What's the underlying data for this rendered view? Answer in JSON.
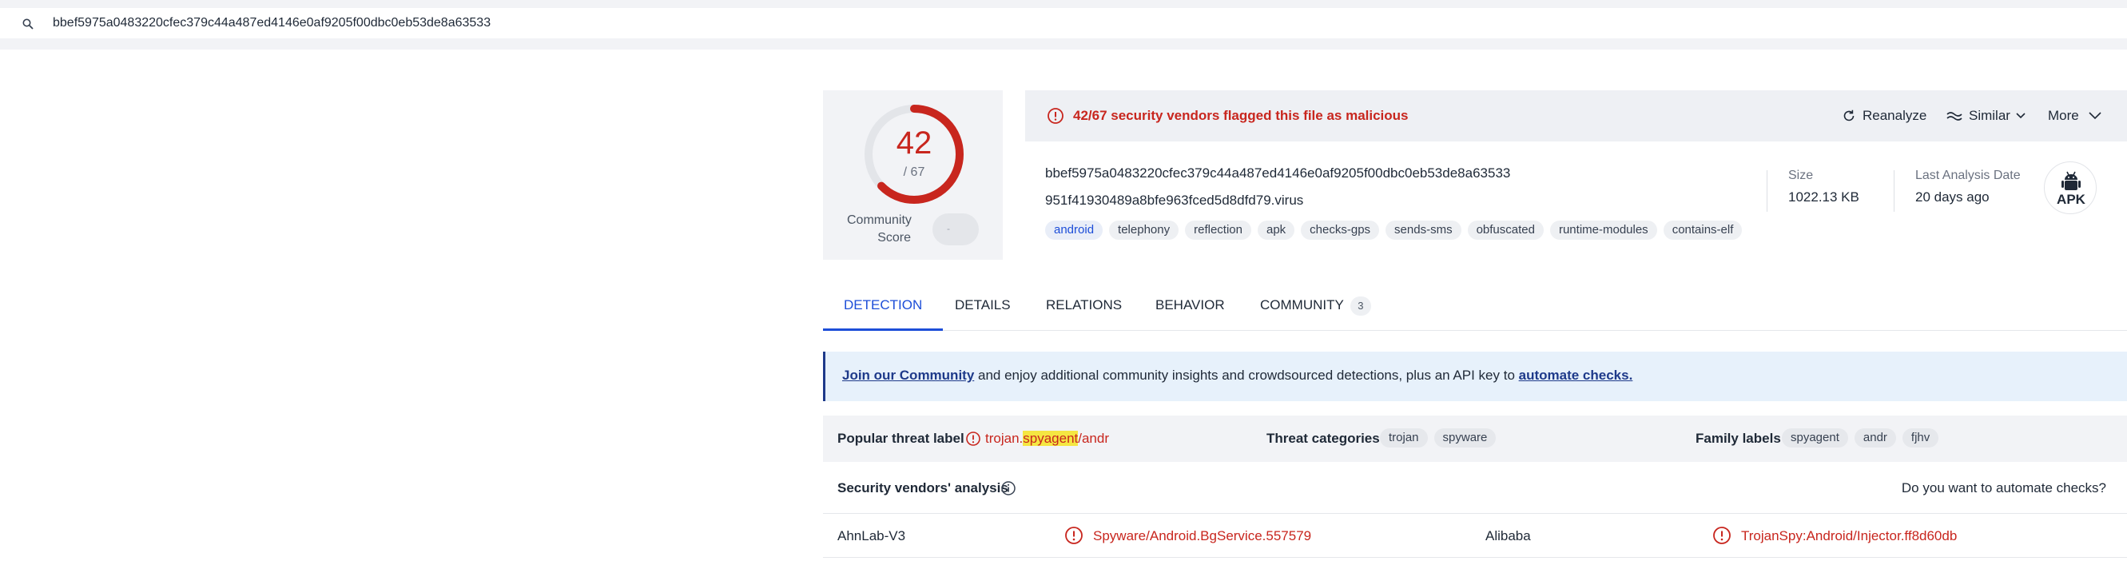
{
  "search": {
    "value": "bbef5975a0483220cfec379c44a487ed4146e0af9205f00dbc0eb53de8a63533",
    "icon": "search-icon"
  },
  "score": {
    "detections": "42",
    "total": "/ 67",
    "fraction": 0.627,
    "community_label": "Community Score",
    "community_toggle": "-",
    "ring_color": "#c8261e"
  },
  "alert": {
    "text": "42/67 security vendors flagged this file as malicious",
    "icon": "alert-circle-icon"
  },
  "actions": {
    "reanalyze": "Reanalyze",
    "similar": "Similar",
    "more": "More"
  },
  "file": {
    "hash": "bbef5975a0483220cfec379c44a487ed4146e0af9205f00dbc0eb53de8a63533",
    "name": "951f41930489a8bfe963fced5d8dfd79.virus",
    "tags": [
      "android",
      "telephony",
      "reflection",
      "apk",
      "checks-gps",
      "sends-sms",
      "obfuscated",
      "runtime-modules",
      "contains-elf"
    ]
  },
  "meta": {
    "size_label": "Size",
    "size_value": "1022.13 KB",
    "date_label": "Last Analysis Date",
    "date_value": "20 days ago",
    "type_badge": "APK"
  },
  "tabs": [
    {
      "label": "DETECTION"
    },
    {
      "label": "DETAILS"
    },
    {
      "label": "RELATIONS"
    },
    {
      "label": "BEHAVIOR"
    },
    {
      "label": "COMMUNITY",
      "count": "3"
    }
  ],
  "banner": {
    "link1": "Join our Community",
    "text": " and enjoy additional community insights and crowdsourced detections, plus an API key to ",
    "link2": "automate checks."
  },
  "threat": {
    "popular_label": "Popular threat label",
    "popular_prefix": "trojan.",
    "popular_highlight": "spyagent",
    "popular_suffix": "/andr",
    "categories_label": "Threat categories",
    "categories": [
      "trojan",
      "spyware"
    ],
    "family_label": "Family labels",
    "families": [
      "spyagent",
      "andr",
      "fjhv"
    ]
  },
  "vendors": {
    "title": "Security vendors' analysis",
    "automate_prompt": "Do you want to automate checks?",
    "rows": [
      {
        "vendor1": "AhnLab-V3",
        "result1": "Spyware/Android.BgService.557579",
        "vendor2": "Alibaba",
        "result2": "TrojanSpy:Android/Injector.ff8d60db"
      }
    ]
  },
  "colors": {
    "malicious": "#c8261e",
    "accent": "#1d4ed8",
    "banner_bg": "#e7f1fb"
  }
}
